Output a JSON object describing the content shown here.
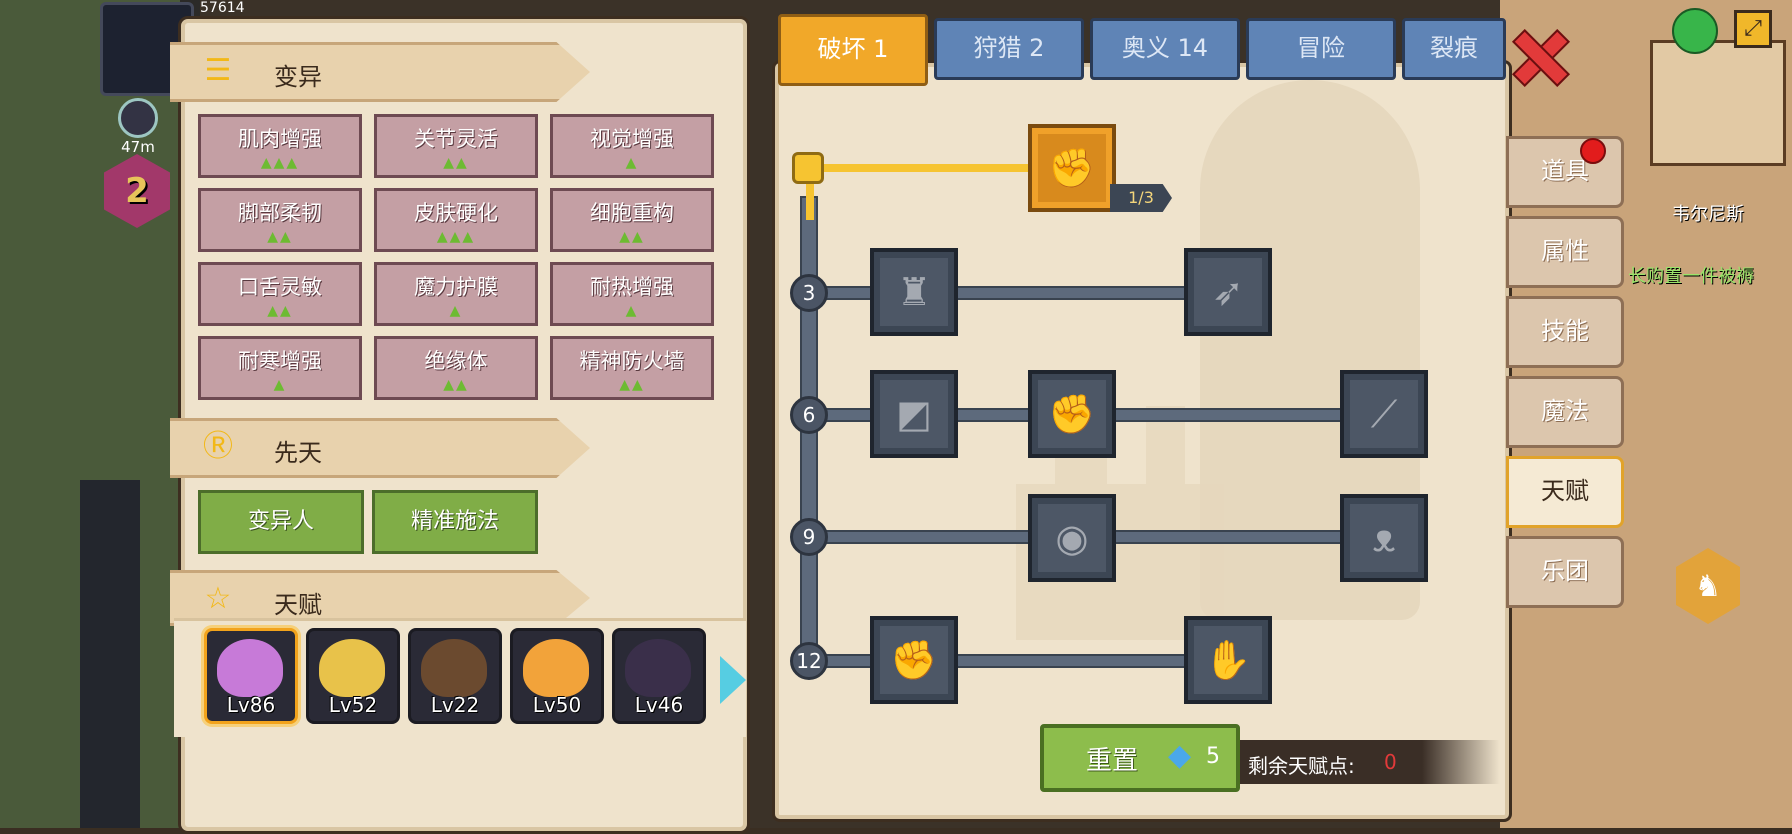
{
  "left_panel": {
    "mutation": {
      "title": "变异",
      "icon": "dna-icon",
      "items": [
        {
          "label": "肌肉增强",
          "level": 3
        },
        {
          "label": "关节灵活",
          "level": 2
        },
        {
          "label": "视觉增强",
          "level": 1
        },
        {
          "label": "脚部柔韧",
          "level": 2
        },
        {
          "label": "皮肤硬化",
          "level": 3
        },
        {
          "label": "细胞重构",
          "level": 2
        },
        {
          "label": "口舌灵敏",
          "level": 2
        },
        {
          "label": "魔力护膜",
          "level": 1
        },
        {
          "label": "耐热增强",
          "level": 1
        },
        {
          "label": "耐寒增强",
          "level": 1
        },
        {
          "label": "绝缘体",
          "level": 2
        },
        {
          "label": "精神防火墙",
          "level": 2
        }
      ]
    },
    "innate": {
      "title": "先天",
      "icon": "r-coin-icon",
      "items": [
        "变异人",
        "精准施法"
      ]
    },
    "talent": {
      "title": "天赋",
      "icon": "star-icon"
    },
    "heroes": [
      {
        "level": "Lv86",
        "color": "#c77ad8",
        "selected": true
      },
      {
        "level": "Lv52",
        "color": "#e8c24a",
        "selected": false
      },
      {
        "level": "Lv22",
        "color": "#6b4a2f",
        "selected": false
      },
      {
        "level": "Lv50",
        "color": "#f2a33a",
        "selected": false
      },
      {
        "level": "Lv46",
        "color": "#3a2f4a",
        "selected": false
      }
    ]
  },
  "tabs": [
    {
      "label": "破坏 1",
      "active": true
    },
    {
      "label": "狩猎 2",
      "active": false
    },
    {
      "label": "奥义 14",
      "active": false
    },
    {
      "label": "冒险",
      "active": false
    },
    {
      "label": "裂痕",
      "active": false
    }
  ],
  "talent_tree": {
    "levels": [
      "3",
      "6",
      "9",
      "12"
    ],
    "first_skill_progress": "1/3",
    "icons": {
      "root": "arm-wrestle-icon",
      "r3a": "giant-icon",
      "r3b": "arrow-strike-icon",
      "r6a": "shield-break-icon",
      "r6b": "fist-punch-icon",
      "r6c": "slash-icon",
      "r9a": "shockwave-icon",
      "r9b": "bat-icon",
      "r12a": "raised-fist-icon",
      "r12b": "fist-down-icon"
    }
  },
  "reset": {
    "label": "重置",
    "cost": "5"
  },
  "remaining": {
    "label": "剩余天赋点:",
    "value": "0"
  },
  "side_menu": [
    "道具",
    "属性",
    "技能",
    "魔法",
    "天赋",
    "乐团"
  ],
  "side_active": "天赋",
  "hud": {
    "top_stat": "57614",
    "distance": "47m",
    "badge_level": "2",
    "location": "韦尔尼斯",
    "notice": "长购置一件被褥"
  },
  "colors": {
    "accent": "#f1a829",
    "tab_blue": "#5f84b6",
    "panel": "#efe3cc",
    "mutation_cell": "#c49fa4",
    "innate_cell": "#80ad47"
  }
}
